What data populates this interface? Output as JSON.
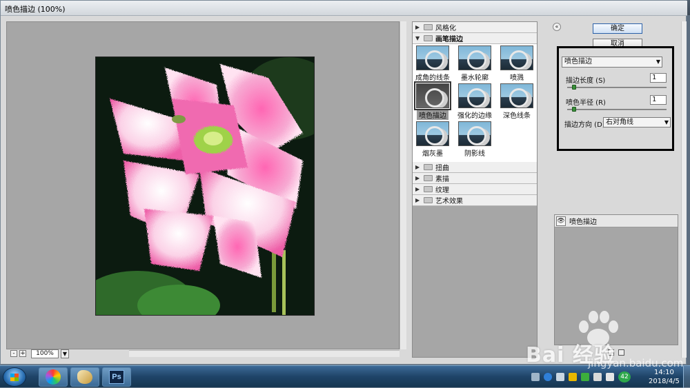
{
  "window": {
    "title": "喷色描边 (100%)"
  },
  "zoom": {
    "value": "100%",
    "minus": "-",
    "plus": "+"
  },
  "filter_gallery": {
    "categories_top": [
      {
        "label": "风格化",
        "open": false
      },
      {
        "label": "画笔描边",
        "open": true
      }
    ],
    "thumbnails": [
      {
        "label": "成角的线条"
      },
      {
        "label": "墨水轮廓"
      },
      {
        "label": "喷溅"
      },
      {
        "label": "喷色描边",
        "selected": true
      },
      {
        "label": "强化的边缘"
      },
      {
        "label": "深色线条"
      },
      {
        "label": "烟灰墨"
      },
      {
        "label": "阴影线"
      }
    ],
    "categories_bottom": [
      {
        "label": "扭曲"
      },
      {
        "label": "素描"
      },
      {
        "label": "纹理"
      },
      {
        "label": "艺术效果"
      }
    ]
  },
  "controls": {
    "ok_label": "确定",
    "cancel_label": "取消",
    "filter_select": "喷色描边",
    "stroke_length_label": "描边长度 (S)",
    "stroke_length_value": "1",
    "spray_radius_label": "喷色半径 (R)",
    "spray_radius_value": "1",
    "stroke_direction_label": "描边方向 (D):",
    "stroke_direction_value": "右对角线",
    "stroke_length_level": 0.05,
    "spray_radius_level": 0.05
  },
  "layers": {
    "effect_layer_label": "喷色描边"
  },
  "taskbar": {
    "ps_label": "Ps",
    "tray_badge": "42",
    "clock_time": "14:10",
    "clock_date": "2018/4/5"
  },
  "watermark": {
    "brand": "Bai 经验",
    "url": "jingyan.baidu.com"
  },
  "colors": {
    "selection_border": "#000000",
    "ok_button_border": "#2a60a8",
    "taskbar": "#1f4468"
  }
}
